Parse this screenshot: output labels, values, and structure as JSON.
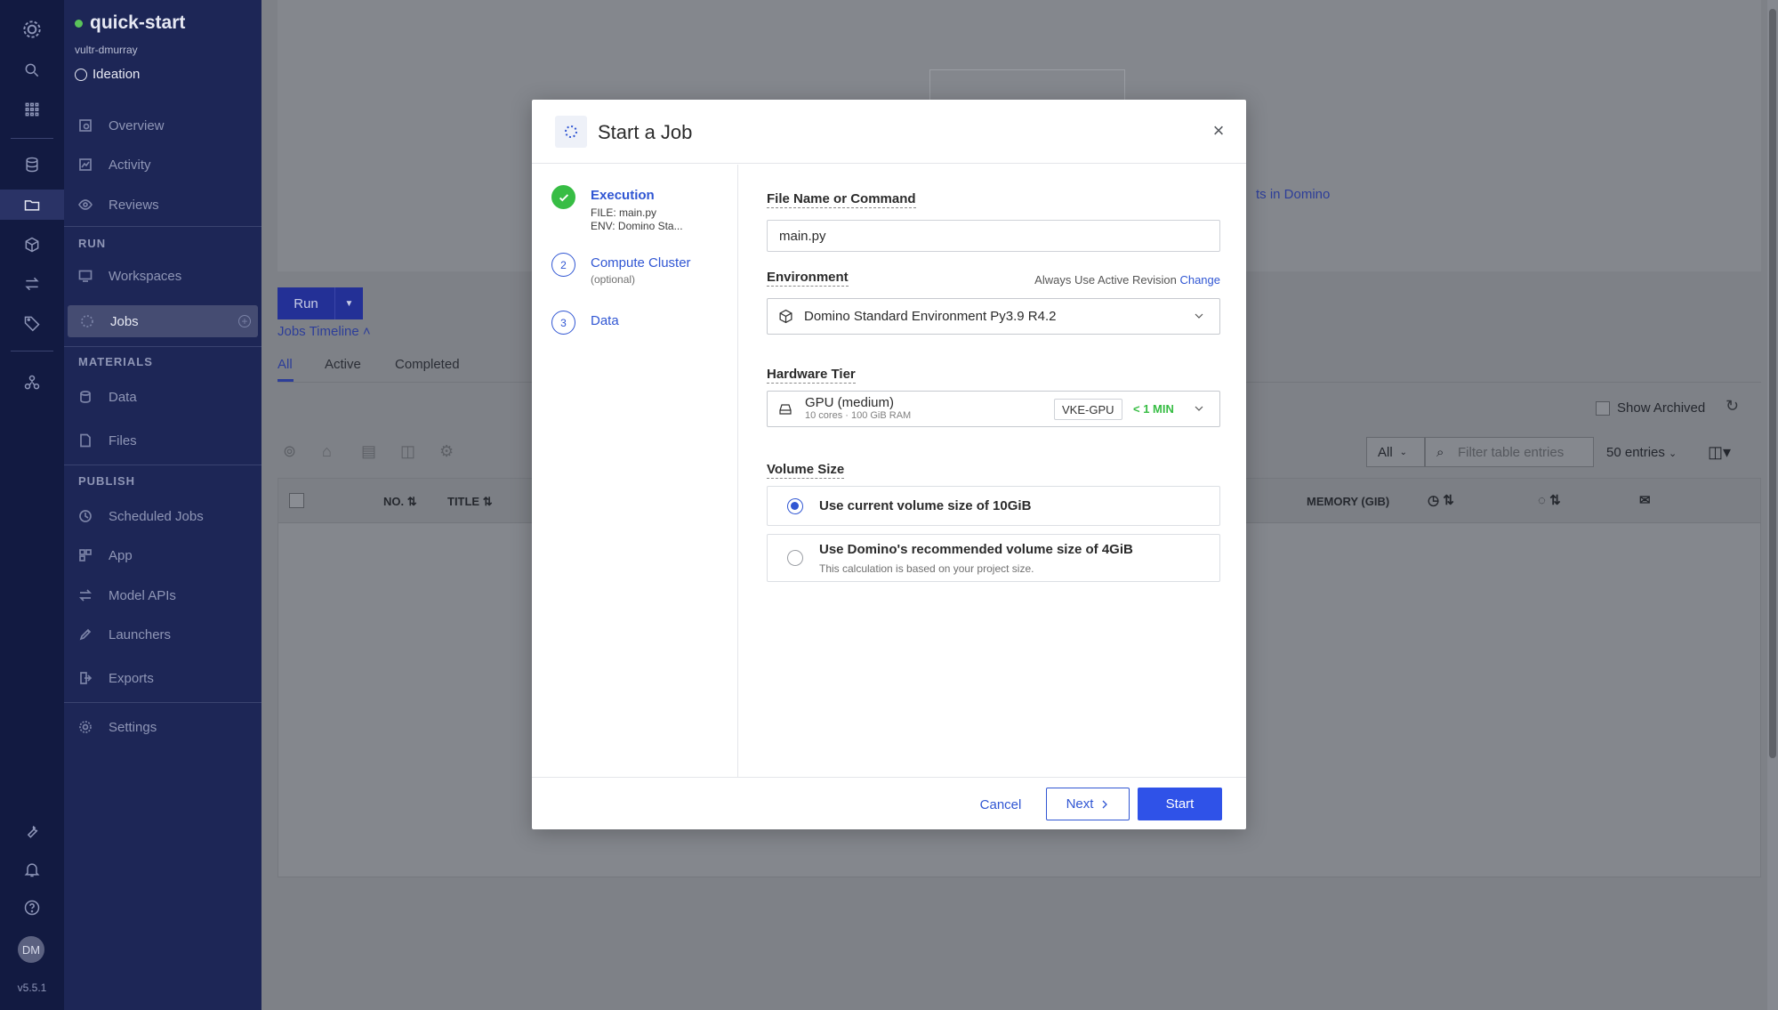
{
  "app": {
    "project_name": "quick-start",
    "owner": "vultr-dmurray",
    "stage": "Ideation",
    "version": "v5.5.1",
    "user_initials": "DM"
  },
  "sidebar": {
    "overview": "Overview",
    "activity": "Activity",
    "reviews": "Reviews",
    "run_section": "RUN",
    "workspaces": "Workspaces",
    "jobs": "Jobs",
    "materials_section": "MATERIALS",
    "data": "Data",
    "files": "Files",
    "publish_section": "PUBLISH",
    "scheduled_jobs": "Scheduled Jobs",
    "app": "App",
    "model_apis": "Model APIs",
    "launchers": "Launchers",
    "exports": "Exports",
    "settings": "Settings"
  },
  "background": {
    "link_fragment": "ts in Domino",
    "run_button": "Run",
    "jobs_timeline": "Jobs Timeline",
    "tabs": [
      "All",
      "Active",
      "Completed"
    ],
    "show_archived": "Show Archived",
    "filter_all": "All",
    "filter_placeholder": "Filter table entries",
    "entries": "50 entries",
    "columns": {
      "no": "NO.",
      "title": "TITLE",
      "memory": "MEMORY (GIB)"
    }
  },
  "modal": {
    "title": "Start a Job",
    "steps": [
      {
        "number": "1",
        "label": "Execution",
        "file": "FILE: main.py",
        "env": "ENV: Domino Sta..."
      },
      {
        "number": "2",
        "label": "Compute Cluster",
        "sub": "(optional)"
      },
      {
        "number": "3",
        "label": "Data"
      }
    ],
    "file_label": "File Name or Command",
    "file_value": "main.py",
    "environment_label": "Environment",
    "revision_text": "Always Use Active Revision",
    "revision_change": "Change",
    "environment_value": "Domino Standard Environment Py3.9 R4.2",
    "hardware_label": "Hardware Tier",
    "hardware_name": "GPU (medium)",
    "hardware_spec": "10 cores · 100 GiB RAM",
    "hardware_badge": "VKE-GPU",
    "hardware_time": "< 1 MIN",
    "volume_label": "Volume Size",
    "volume_option_current": "Use current volume size of 10GiB",
    "volume_option_recommended": "Use Domino's recommended volume size of 4GiB",
    "volume_option_recommended_sub": "This calculation is based on your project size.",
    "cancel": "Cancel",
    "next": "Next",
    "start": "Start"
  },
  "colors": {
    "primary": "#2f52e8",
    "link": "#3056d3",
    "success": "#37bd44",
    "sidebar": "#1d2656",
    "rail": "#121a41"
  }
}
